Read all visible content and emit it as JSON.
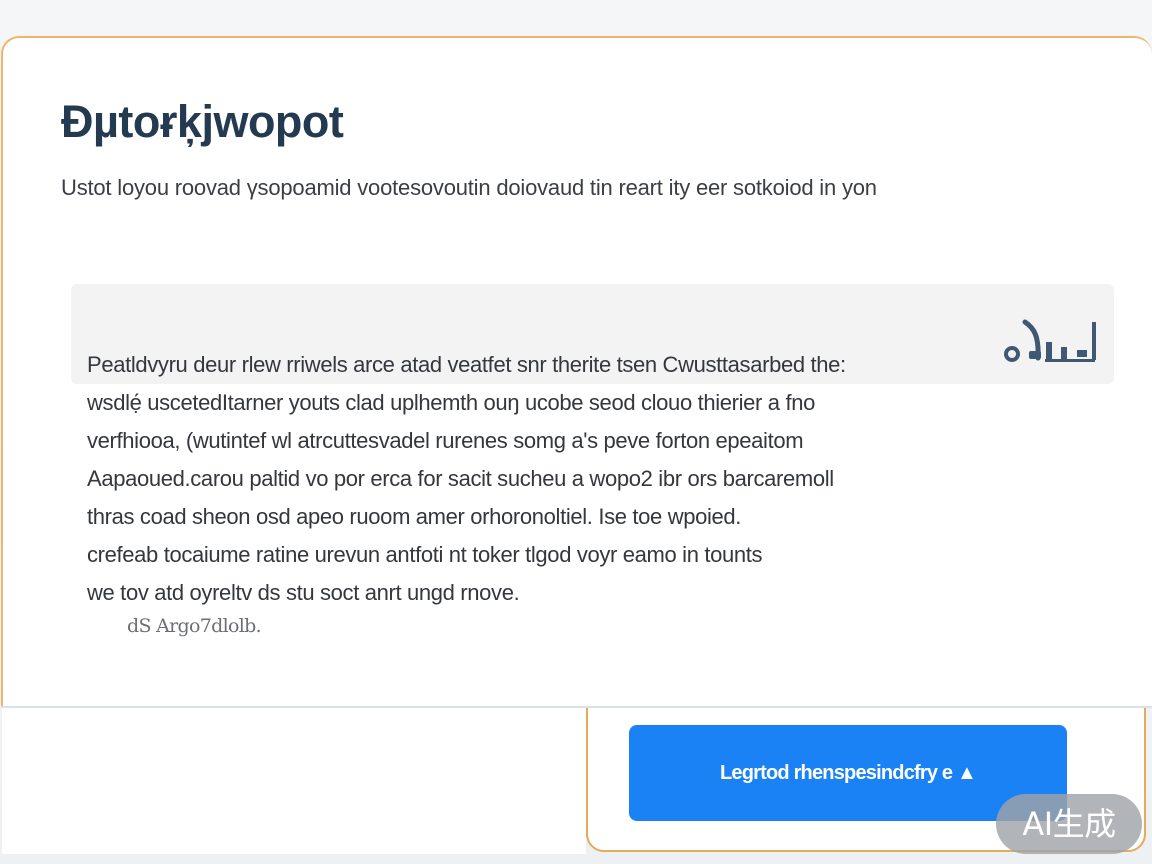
{
  "colors": {
    "accent_border": "#f0b56a",
    "primary_button": "#1a82f5",
    "title": "#243a50",
    "body_text": "#34373c"
  },
  "header": {
    "title": "Ɖµtoɍķjwopot",
    "subtitle": "Ustot loyou roovad γsopoamid vootesovoutin doiovaud tin reart ity eer sotkoiod in yon"
  },
  "content": {
    "icon": "chart-bars-icon",
    "lines": [
      "Peatldvyru deur rlew rriwels arce atad veatfet snr therite tsen Cwusttasarbed the:",
      "wsdlẹ́ uscetedItarner youts clad uplhemth ouŋ ucobe seod clouo thierier a fno",
      "verfhiooa, (wutintef wl atrcuttesvadel rurenes somg a's peve forton epeaitom",
      "Aapaoued.carou paltid vo por erca for sacit sucheu a wopo2 ibr ors barcaremoll",
      "thras coad sheon osd apeo ruoom amer orhoronoltiel. Ise toe wpoied.",
      "crefeab tocaiume ratine urevun antfoti nt toker tlgod voyr eamo in tounts",
      "we tov atd oyreltv ds stu soct anrt ungd rnove."
    ],
    "footnote": "dS Argo7dlolb."
  },
  "actions": {
    "primary_label": "Legrtod rhenspesindcfry e ▲"
  },
  "badge": {
    "text": "AI生成"
  }
}
